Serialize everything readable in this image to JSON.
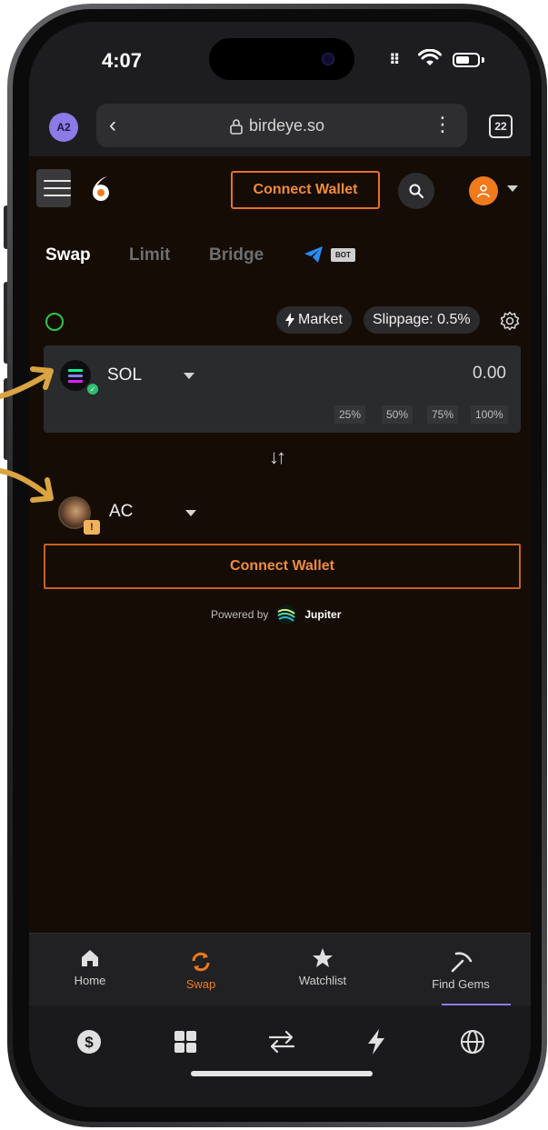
{
  "status_bar": {
    "time": "4:07"
  },
  "browser": {
    "profile_initials": "A2",
    "url": "birdeye.so",
    "tab_count": "22"
  },
  "header": {
    "connect_label": "Connect Wallet"
  },
  "mode_tabs": [
    {
      "label": "Swap",
      "active": true
    },
    {
      "label": "Limit",
      "active": false
    },
    {
      "label": "Bridge",
      "active": false
    }
  ],
  "bot_badge": "BOT",
  "controls": {
    "market_label": "Market",
    "slippage_label": "Slippage: 0.5%"
  },
  "from_token": {
    "symbol": "SOL",
    "amount": "0.00",
    "percent_options": [
      "25%",
      "50%",
      "75%",
      "100%"
    ]
  },
  "to_token": {
    "symbol": "AC"
  },
  "connect_main_label": "Connect Wallet",
  "powered": {
    "prefix": "Powered by",
    "brand": "Jupiter"
  },
  "bottom_nav": [
    {
      "label": "Home",
      "icon": "home-icon",
      "active": false
    },
    {
      "label": "Swap",
      "icon": "swap-icon",
      "active": true
    },
    {
      "label": "Watchlist",
      "icon": "star-icon",
      "active": false
    },
    {
      "label": "Find Gems",
      "icon": "pickaxe-icon",
      "active": false
    }
  ],
  "toolbar_icons": [
    "dollar-icon",
    "grid-icon",
    "transfer-icon",
    "lightning-icon",
    "globe-icon"
  ],
  "colors": {
    "accent": "#f07a1c",
    "background": "#150c06",
    "card": "#2a2b2d",
    "success": "#2fc74a",
    "annotation_arrow": "#d9a441"
  }
}
